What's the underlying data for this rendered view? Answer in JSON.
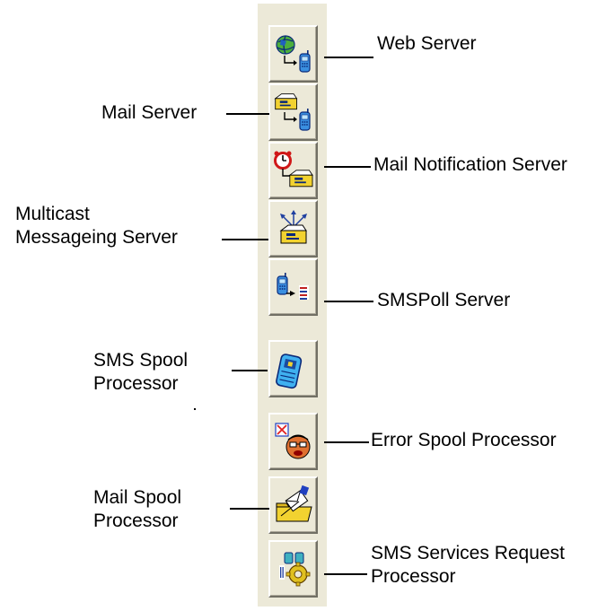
{
  "buttons": [
    {
      "id": "web",
      "icon": "globe-to-phone-icon"
    },
    {
      "id": "mail",
      "icon": "mailbox-to-phone-icon"
    },
    {
      "id": "mail-notification",
      "icon": "alarm-clock-mailbox-icon"
    },
    {
      "id": "multicast",
      "icon": "multicast-mailbox-icon"
    },
    {
      "id": "smspoll",
      "icon": "phone-to-list-icon"
    },
    {
      "id": "sms-spool",
      "icon": "mobile-phone-icon"
    },
    {
      "id": "error-spool",
      "icon": "angry-face-error-icon"
    },
    {
      "id": "mail-spool",
      "icon": "folder-letter-icon"
    },
    {
      "id": "sms-services",
      "icon": "services-gear-icon"
    }
  ],
  "labels": {
    "web": [
      "Web Server"
    ],
    "mail": [
      "Mail Server"
    ],
    "mail_notification": [
      "Mail Notification Server"
    ],
    "multicast": [
      "Multicast",
      "Messageing Server"
    ],
    "smspoll": [
      "SMSPoll Server"
    ],
    "sms_spool": [
      "SMS Spool",
      "Processor"
    ],
    "error_spool": [
      "Error Spool Processor"
    ],
    "mail_spool": [
      "Mail Spool",
      "Processor"
    ],
    "sms_services": [
      "SMS Services Request",
      "Processor"
    ]
  },
  "colors": {
    "toolbar_bg": "#ece9d8",
    "phone_blue": "#3a8fe0",
    "mailbox_yellow": "#f2d230",
    "globe_green": "#4caf3c",
    "alarm_red": "#d01818"
  }
}
